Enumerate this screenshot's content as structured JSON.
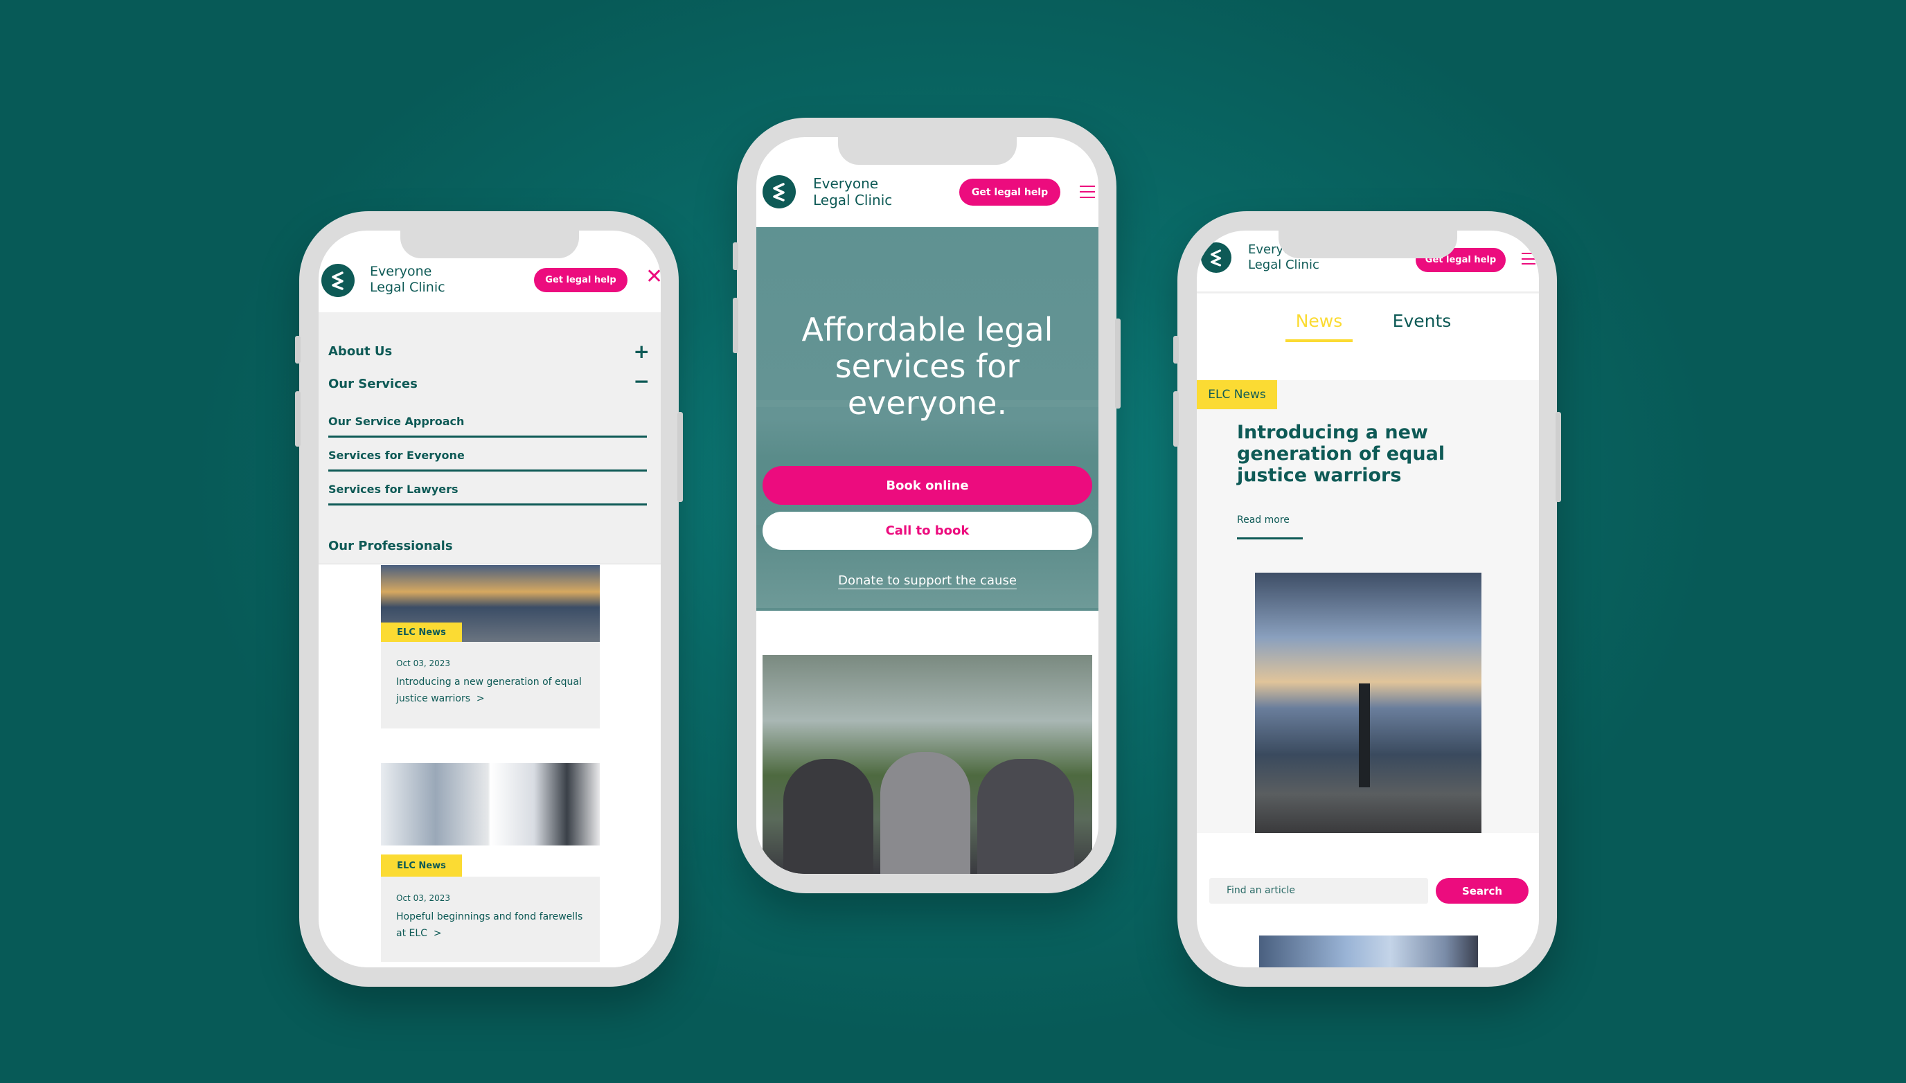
{
  "brand": {
    "line1": "Everyone",
    "line2": "Legal Clinic",
    "cta": "Get legal help",
    "accent": "#ec0c7e",
    "primary": "#0e5a56",
    "highlight": "#fbdb33"
  },
  "left_phone": {
    "menu": [
      {
        "label": "About Us",
        "icon": "plus-icon"
      },
      {
        "label": "Our Services",
        "icon": "minus-icon"
      }
    ],
    "submenu": [
      "Our Service Approach",
      "Services for Everyone",
      "Services for Lawyers"
    ],
    "section": "Our Professionals",
    "cards": [
      {
        "tag": "ELC News",
        "date": "Oct 03, 2023",
        "title": "Introducing a new generation of equal justice warriors",
        "arrow": ">"
      },
      {
        "tag": "ELC News",
        "date": "Oct 03, 2023",
        "title": "Hopeful beginnings and fond farewells at ELC",
        "arrow": ">"
      }
    ]
  },
  "center_phone": {
    "headline": [
      "Affordable legal",
      "services for",
      "everyone."
    ],
    "book_online": "Book online",
    "call_to_book": "Call to book",
    "donate": "Donate to support the cause"
  },
  "right_phone": {
    "tabs": [
      {
        "label": "News",
        "active": true
      },
      {
        "label": "Events",
        "active": false
      }
    ],
    "tag": "ELC News",
    "article_title": "Introducing a new generation of equal justice warriors",
    "read_more": "Read more",
    "search_placeholder": "Find an article",
    "search_button": "Search"
  }
}
